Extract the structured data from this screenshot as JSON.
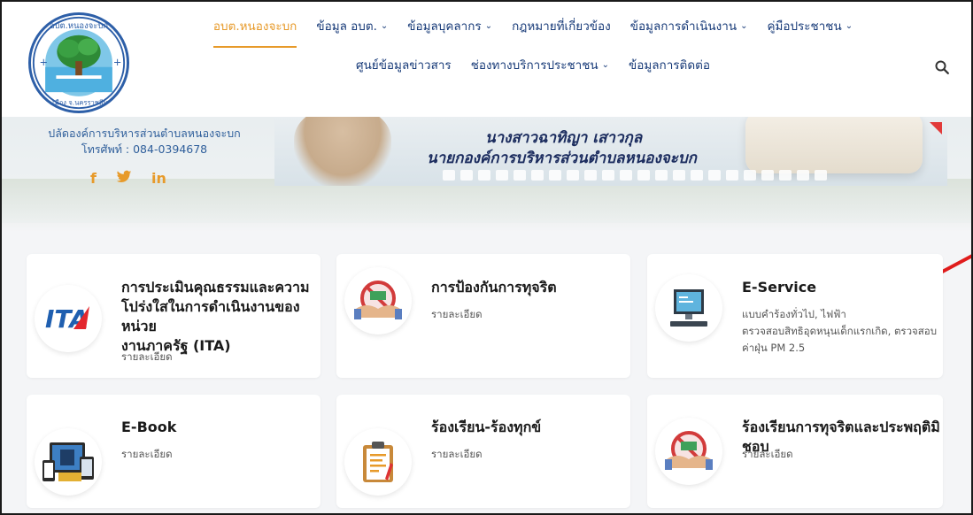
{
  "header": {
    "logo_text_top": "อบต.หนองจะบก",
    "logo_text_bottom": "อ.เมือง จ.นครราชสีมา",
    "nav_row1": [
      {
        "label": "อบต.หนองจะบก",
        "chevron": false,
        "active": true
      },
      {
        "label": "ข้อมูล อบต.",
        "chevron": true,
        "active": false
      },
      {
        "label": "ข้อมูลบุคลากร",
        "chevron": true,
        "active": false
      },
      {
        "label": "กฎหมายที่เกี่ยวข้อง",
        "chevron": false,
        "active": false
      },
      {
        "label": "ข้อมูลการดำเนินงาน",
        "chevron": true,
        "active": false
      },
      {
        "label": "คู่มือประชาชน",
        "chevron": true,
        "active": false
      }
    ],
    "nav_row2": [
      {
        "label": "ศูนย์ข้อมูลข่าวสาร",
        "chevron": false
      },
      {
        "label": "ช่องทางบริการประชาชน",
        "chevron": true
      },
      {
        "label": "ข้อมูลการติดต่อ",
        "chevron": false
      }
    ],
    "search_icon": "search-icon"
  },
  "contact": {
    "org": "ปลัดองค์การบริหารส่วนตำบลหนองจะบก",
    "phone": "โทรศัพท์ : 084-0394678",
    "social": [
      "f",
      "y",
      "in"
    ]
  },
  "banner": {
    "line1": "นางสาวฉาทิญา เสาวกุล",
    "line2": "นายกองค์การบริหารส่วนตำบลหนองจะบก"
  },
  "cards": [
    {
      "title_lines": [
        "การประเมินคุณธรรมและความ",
        "โปร่งใสในการดำเนินงานของหน่วย",
        "งานภาครัฐ (ITA)"
      ],
      "sub_lines": [
        "รายละเอียด"
      ],
      "icon": "ita-logo-icon"
    },
    {
      "title_lines": [
        "การป้องกันการทุจริต"
      ],
      "sub_lines": [
        "รายละเอียด"
      ],
      "icon": "anti-corruption-icon"
    },
    {
      "title_lines": [
        "E-Service"
      ],
      "sub_lines": [
        "แบบคำร้องทั่วไป, ไฟฟ้า",
        "ตรวจสอบสิทธิอุดหนุนเด็กแรกเกิด, ตรวจสอบ",
        "ค่าฝุ่น PM 2.5"
      ],
      "icon": "computer-icon"
    },
    {
      "title_lines": [
        "E-Book"
      ],
      "sub_lines": [
        "รายละเอียด"
      ],
      "icon": "ebook-devices-icon"
    },
    {
      "title_lines": [
        "ร้องเรียน-ร้องทุกข์"
      ],
      "sub_lines": [
        "รายละเอียด"
      ],
      "icon": "clipboard-icon"
    },
    {
      "title_lines": [
        "ร้องเรียนการทุจริตและประพฤติมิชอบ"
      ],
      "sub_lines": [
        "รายละเอียด"
      ],
      "icon": "anti-corruption-icon"
    }
  ],
  "colors": {
    "nav_text": "#173a78",
    "accent": "#e79a2a",
    "arrow": "#e01c1c"
  }
}
